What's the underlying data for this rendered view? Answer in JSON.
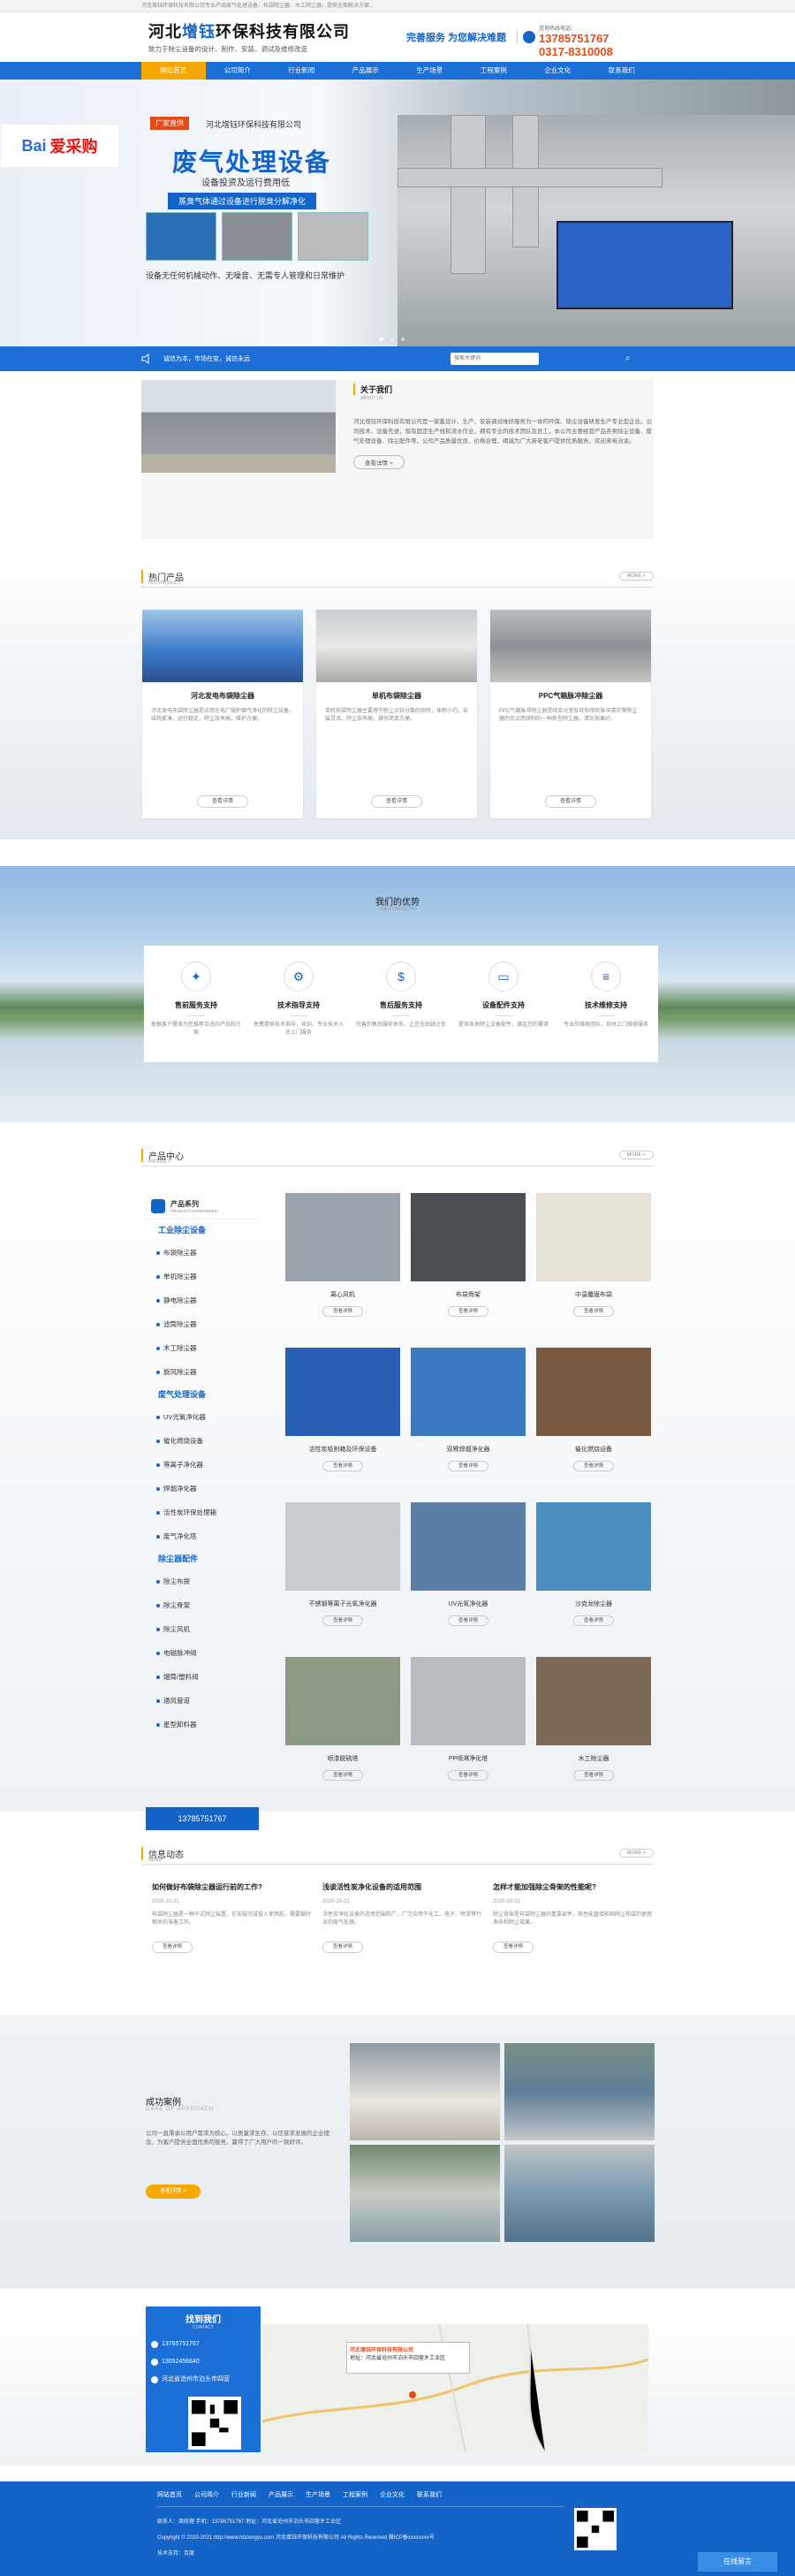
{
  "topbar": {
    "text": "河北增钰环保科技有限公司专业产品废气处理设备、布袋除尘器、木工除尘器，提供全面解决方案..."
  },
  "header": {
    "name_a": "河北",
    "name_b": "增钰",
    "name_c": "环保科技有限公司",
    "sub": "致力于除尘设备的设计、制作、安装、调试及维修改造",
    "slogan": "完善服务 为您解决难题",
    "phone_label": "咨询热线电话：",
    "phone1": "13785751767",
    "phone2": "0317-8310008"
  },
  "nav": [
    "网站首页",
    "公司简介",
    "行业新闻",
    "产品展示",
    "生产场景",
    "工程案例",
    "企业文化",
    "联系我们"
  ],
  "banner": {
    "baidu": "爱采购",
    "badge": "厂家直供",
    "company": "河北增钰环保科技有限公司",
    "title": "废气处理设备",
    "sub": "设备投资及运行费用低",
    "tag": "蒸臭气体通过设备进行脱臭分解净化",
    "foot": "设备无任何机械动作、无噪音、无需专人管理和日常维护"
  },
  "notice": {
    "text": "诚信为本，市场在变，诚信永远",
    "search_placeholder": "搜索关键词"
  },
  "about": {
    "title": "关于我们",
    "en": "ABOUT US",
    "p": "河北增钰环保科技有限公司是一家集设计、生产、安装调试维修服务为一体的环保、除尘设备研发生产专业型企业。公司技术、设备先进，现有固定生产线和流水作业，拥有专业的技术团队及员工，本公司主要经营产品各类除尘设备、废气处理设备、除尘配件等，公司产品质量优良、价格合理，竭诚为广大新老客户提供优质服务，欢迎来电洽谈。",
    "btn": "查看详情 >"
  },
  "hot": {
    "title": "热门产品",
    "en": "HOT PRODUCT",
    "more": "MORE >",
    "items": [
      {
        "name": "河北发电布袋除尘器",
        "desc": "河北发电布袋除尘器是应用在电厂锅炉烟气净化的除尘设备，结构紧凑，运行稳定，除尘效率高，维护方便。",
        "btn": "查看详情"
      },
      {
        "name": "单机布袋除尘器",
        "desc": "单机布袋除尘器主要用于粉尘点较分散的场所，体积小巧，安装灵活，除尘效率高，操作简单方便。",
        "btn": "查看详情"
      },
      {
        "name": "PPC气箱脉冲除尘器",
        "desc": "PPC气箱脉冲除尘器是综合分室反吹和喷吹脉冲清灰等除尘器的优点而研制的一种新型除尘器，清灰效果好。",
        "btn": "查看详情"
      }
    ]
  },
  "adv": {
    "title": "我们的优势",
    "en": "OUR STRENGTHS",
    "items": [
      {
        "name": "售前服务支持",
        "desc": "根据客户需求为您推荐合适的产品和方案"
      },
      {
        "name": "技术指导支持",
        "desc": "免费提供技术指导，培训，专业技术人员上门服务"
      },
      {
        "name": "售后服务支持",
        "desc": "完善的售后服务体系，让您无后顾之忧"
      },
      {
        "name": "设备配件支持",
        "desc": "提供各类除尘设备配件，满足您的需求"
      },
      {
        "name": "技术维修支持",
        "desc": "专业的维修团队，及时上门维修服务"
      }
    ]
  },
  "pc": {
    "title": "产品中心",
    "en": "PRODUCT",
    "more": "MORE >",
    "side_title": "产品系列",
    "side_en": "PRODUCT CATEGORIES",
    "cat1": "工业除尘设备",
    "sub1": [
      "布袋除尘器",
      "单机除尘器",
      "静电除尘器",
      "滤筒除尘器",
      "木工除尘器",
      "旋风除尘器"
    ],
    "cat2": "废气处理设备",
    "sub2": [
      "UV光氧净化器",
      "催化燃烧设备",
      "等离子净化器",
      "焊烟净化器",
      "活性炭环保处理箱",
      "废气净化塔"
    ],
    "cat3": "除尘器配件",
    "sub3": [
      "除尘布袋",
      "除尘骨架",
      "除尘风机",
      "电磁脉冲阀",
      "烟筒/塑料阀",
      "通风管道",
      "星型卸料器"
    ],
    "tel": "13785751767",
    "items": [
      {
        "name": "离心风机",
        "btn": "查看详情"
      },
      {
        "name": "布袋骨架",
        "btn": "查看详情"
      },
      {
        "name": "中温覆膜布袋",
        "btn": "查看详情"
      },
      {
        "name": "活性炭吸附箱及环保设备",
        "btn": "查看详情"
      },
      {
        "name": "双臂焊烟净化器",
        "btn": "查看详情"
      },
      {
        "name": "催化燃烧设备",
        "btn": "查看详情"
      },
      {
        "name": "不锈钢等离子光氧净化器",
        "btn": "查看详情"
      },
      {
        "name": "UV光氧净化器",
        "btn": "查看详情"
      },
      {
        "name": "沙克龙除尘器",
        "btn": "查看详情"
      },
      {
        "name": "喷漆脱硫塔",
        "btn": "查看详情"
      },
      {
        "name": "PP喷淋净化塔",
        "btn": "查看详情"
      },
      {
        "name": "木工除尘器",
        "btn": "查看详情"
      }
    ]
  },
  "news": {
    "title": "信息动态",
    "en": "NEWS",
    "more": "MORE >",
    "items": [
      {
        "title": "如何做好布袋除尘器运行前的工作?",
        "date": "2020-10-21",
        "p": "布袋除尘器是一种干式除尘装置，在安装完成投入使用前，需要做好相关的准备工作。",
        "btn": "查看详情"
      },
      {
        "title": "浅谈活性炭净化设备的适用范围",
        "date": "2020-10-21",
        "p": "活性炭净化设备的适用范围较广，广泛应用于化工、电子、喷漆等行业的废气处理。",
        "btn": "查看详情"
      },
      {
        "title": "怎样才能加强除尘骨架的性能呢?",
        "date": "2020-10-21",
        "p": "除尘骨架是布袋除尘器的重要部件，其性能直接影响除尘布袋的使用寿命和除尘效果。",
        "btn": "查看详情"
      }
    ]
  },
  "cases": {
    "title": "成功案例",
    "en": "CASE OF APPROACH",
    "p": "公司一直秉承以用户需求为核心，以质量求生存、以信誉求发展的企业理念，为客户提供全面优质的服务，赢得了广大用户的一致好评。",
    "btn": "查看详情 >"
  },
  "contact": {
    "title": "找到我们",
    "en": "CONTACT",
    "tel": "13785751767",
    "phone": "13052456840",
    "addr": "河北省沧州市泊头市四营",
    "map_name": "河北增钰环保科技有限公司",
    "map_addr": "地址：河北省沧州市泊头市四营乡工业区"
  },
  "footer": {
    "nav": [
      "网站首页",
      "公司简介",
      "行业新闻",
      "产品展示",
      "生产场景",
      "工程案例",
      "企业文化",
      "联系我们"
    ],
    "line1": "联系人：周经理      手机：13785751767      地址：河北省沧州市泊头市四营乡工业区",
    "line2": "Copyright © 2020-2021 http://www.hbzengyu.com  河北增钰环保科技有限公司 All Rights Reserved  冀ICP备xxxxxxxx号",
    "line3": "技术支持：百度",
    "online": "在线留言"
  }
}
